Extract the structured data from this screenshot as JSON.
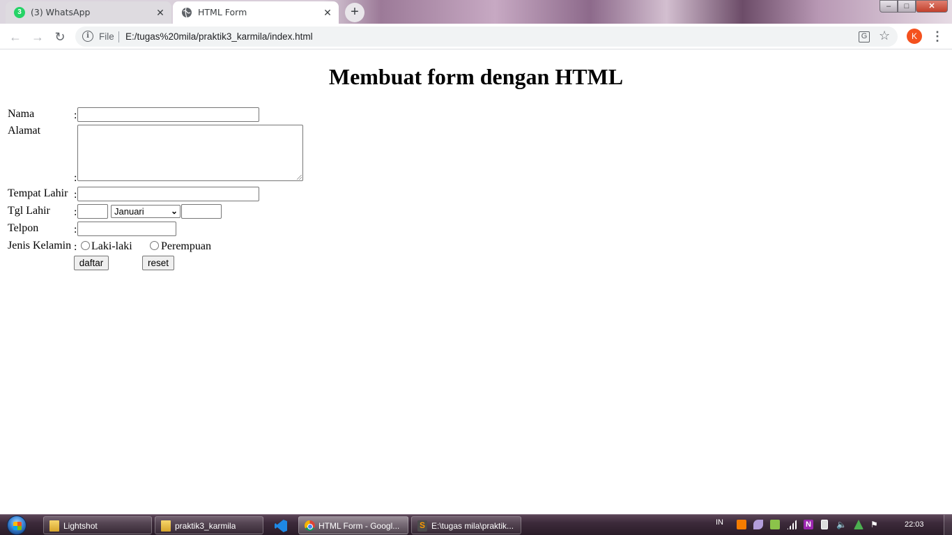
{
  "browser": {
    "tabs": [
      {
        "label": "(3) WhatsApp",
        "badge": "3",
        "icon": "whatsapp-icon",
        "active": false
      },
      {
        "label": "HTML Form",
        "icon": "globe-icon",
        "active": true
      }
    ],
    "close_glyph": "✕",
    "new_tab_glyph": "+",
    "address": {
      "scheme_label": "File",
      "url": "E:/tugas%20mila/praktik3_karmila/index.html"
    },
    "profile_initial": "K",
    "window_controls": {
      "minimize": "–",
      "maximize": "□",
      "close": "✕"
    }
  },
  "form": {
    "heading": "Membuat form dengan HTML",
    "colon": ":",
    "fields": {
      "nama": {
        "label": "Nama",
        "value": ""
      },
      "alamat": {
        "label": "Alamat",
        "value": ""
      },
      "tempat_lahir": {
        "label": "Tempat Lahir",
        "value": ""
      },
      "tgl_lahir": {
        "label": "Tgl Lahir",
        "day": "",
        "month": "Januari",
        "year": ""
      },
      "telpon": {
        "label": "Telpon",
        "value": ""
      },
      "jenis_kelamin": {
        "label": "Jenis Kelamin",
        "options": [
          "Laki-laki",
          "Perempuan"
        ]
      }
    },
    "buttons": {
      "submit": "daftar",
      "reset": "reset"
    }
  },
  "taskbar": {
    "items": [
      {
        "label": "Lightshot",
        "icon": "folder-icon"
      },
      {
        "label": "praktik3_karmila",
        "icon": "folder-icon"
      },
      {
        "label": "HTML Form - Googl...",
        "icon": "chrome-icon",
        "active": true
      },
      {
        "label": "E:\\tugas mila\\praktik...",
        "icon": "sublime-text-icon"
      }
    ],
    "language": "IN",
    "clock": "22:03"
  },
  "colors": {
    "avatar": "#f4511e",
    "whatsapp": "#25d366",
    "close_button": "#c2402c"
  }
}
